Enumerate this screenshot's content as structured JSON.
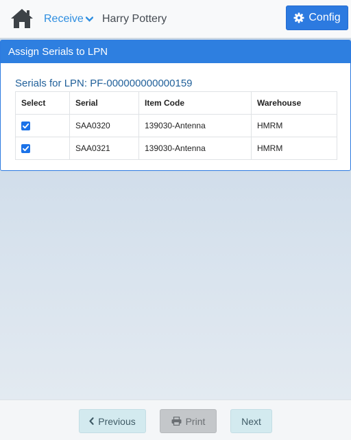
{
  "header": {
    "home_icon": "home-icon",
    "menu_label": "Receive",
    "user_name": "Harry Pottery",
    "config_label": "Config"
  },
  "panel": {
    "title": "Assign Serials to LPN",
    "subtitle": "Serials for LPN: PF-000000000000159",
    "columns": [
      "Select",
      "Serial",
      "Item Code",
      "Warehouse"
    ],
    "rows": [
      {
        "selected": true,
        "serial": "SAA0320",
        "item_code": "139030-Antenna",
        "warehouse": "HMRM"
      },
      {
        "selected": true,
        "serial": "SAA0321",
        "item_code": "139030-Antenna",
        "warehouse": "HMRM"
      }
    ]
  },
  "footer": {
    "previous_label": "Previous",
    "print_label": "Print",
    "next_label": "Next"
  },
  "colors": {
    "accent": "#2c7ae0",
    "link": "#2e8ee0",
    "nav_button": "#d3eaef",
    "disabled_button": "#c4c7ca"
  }
}
